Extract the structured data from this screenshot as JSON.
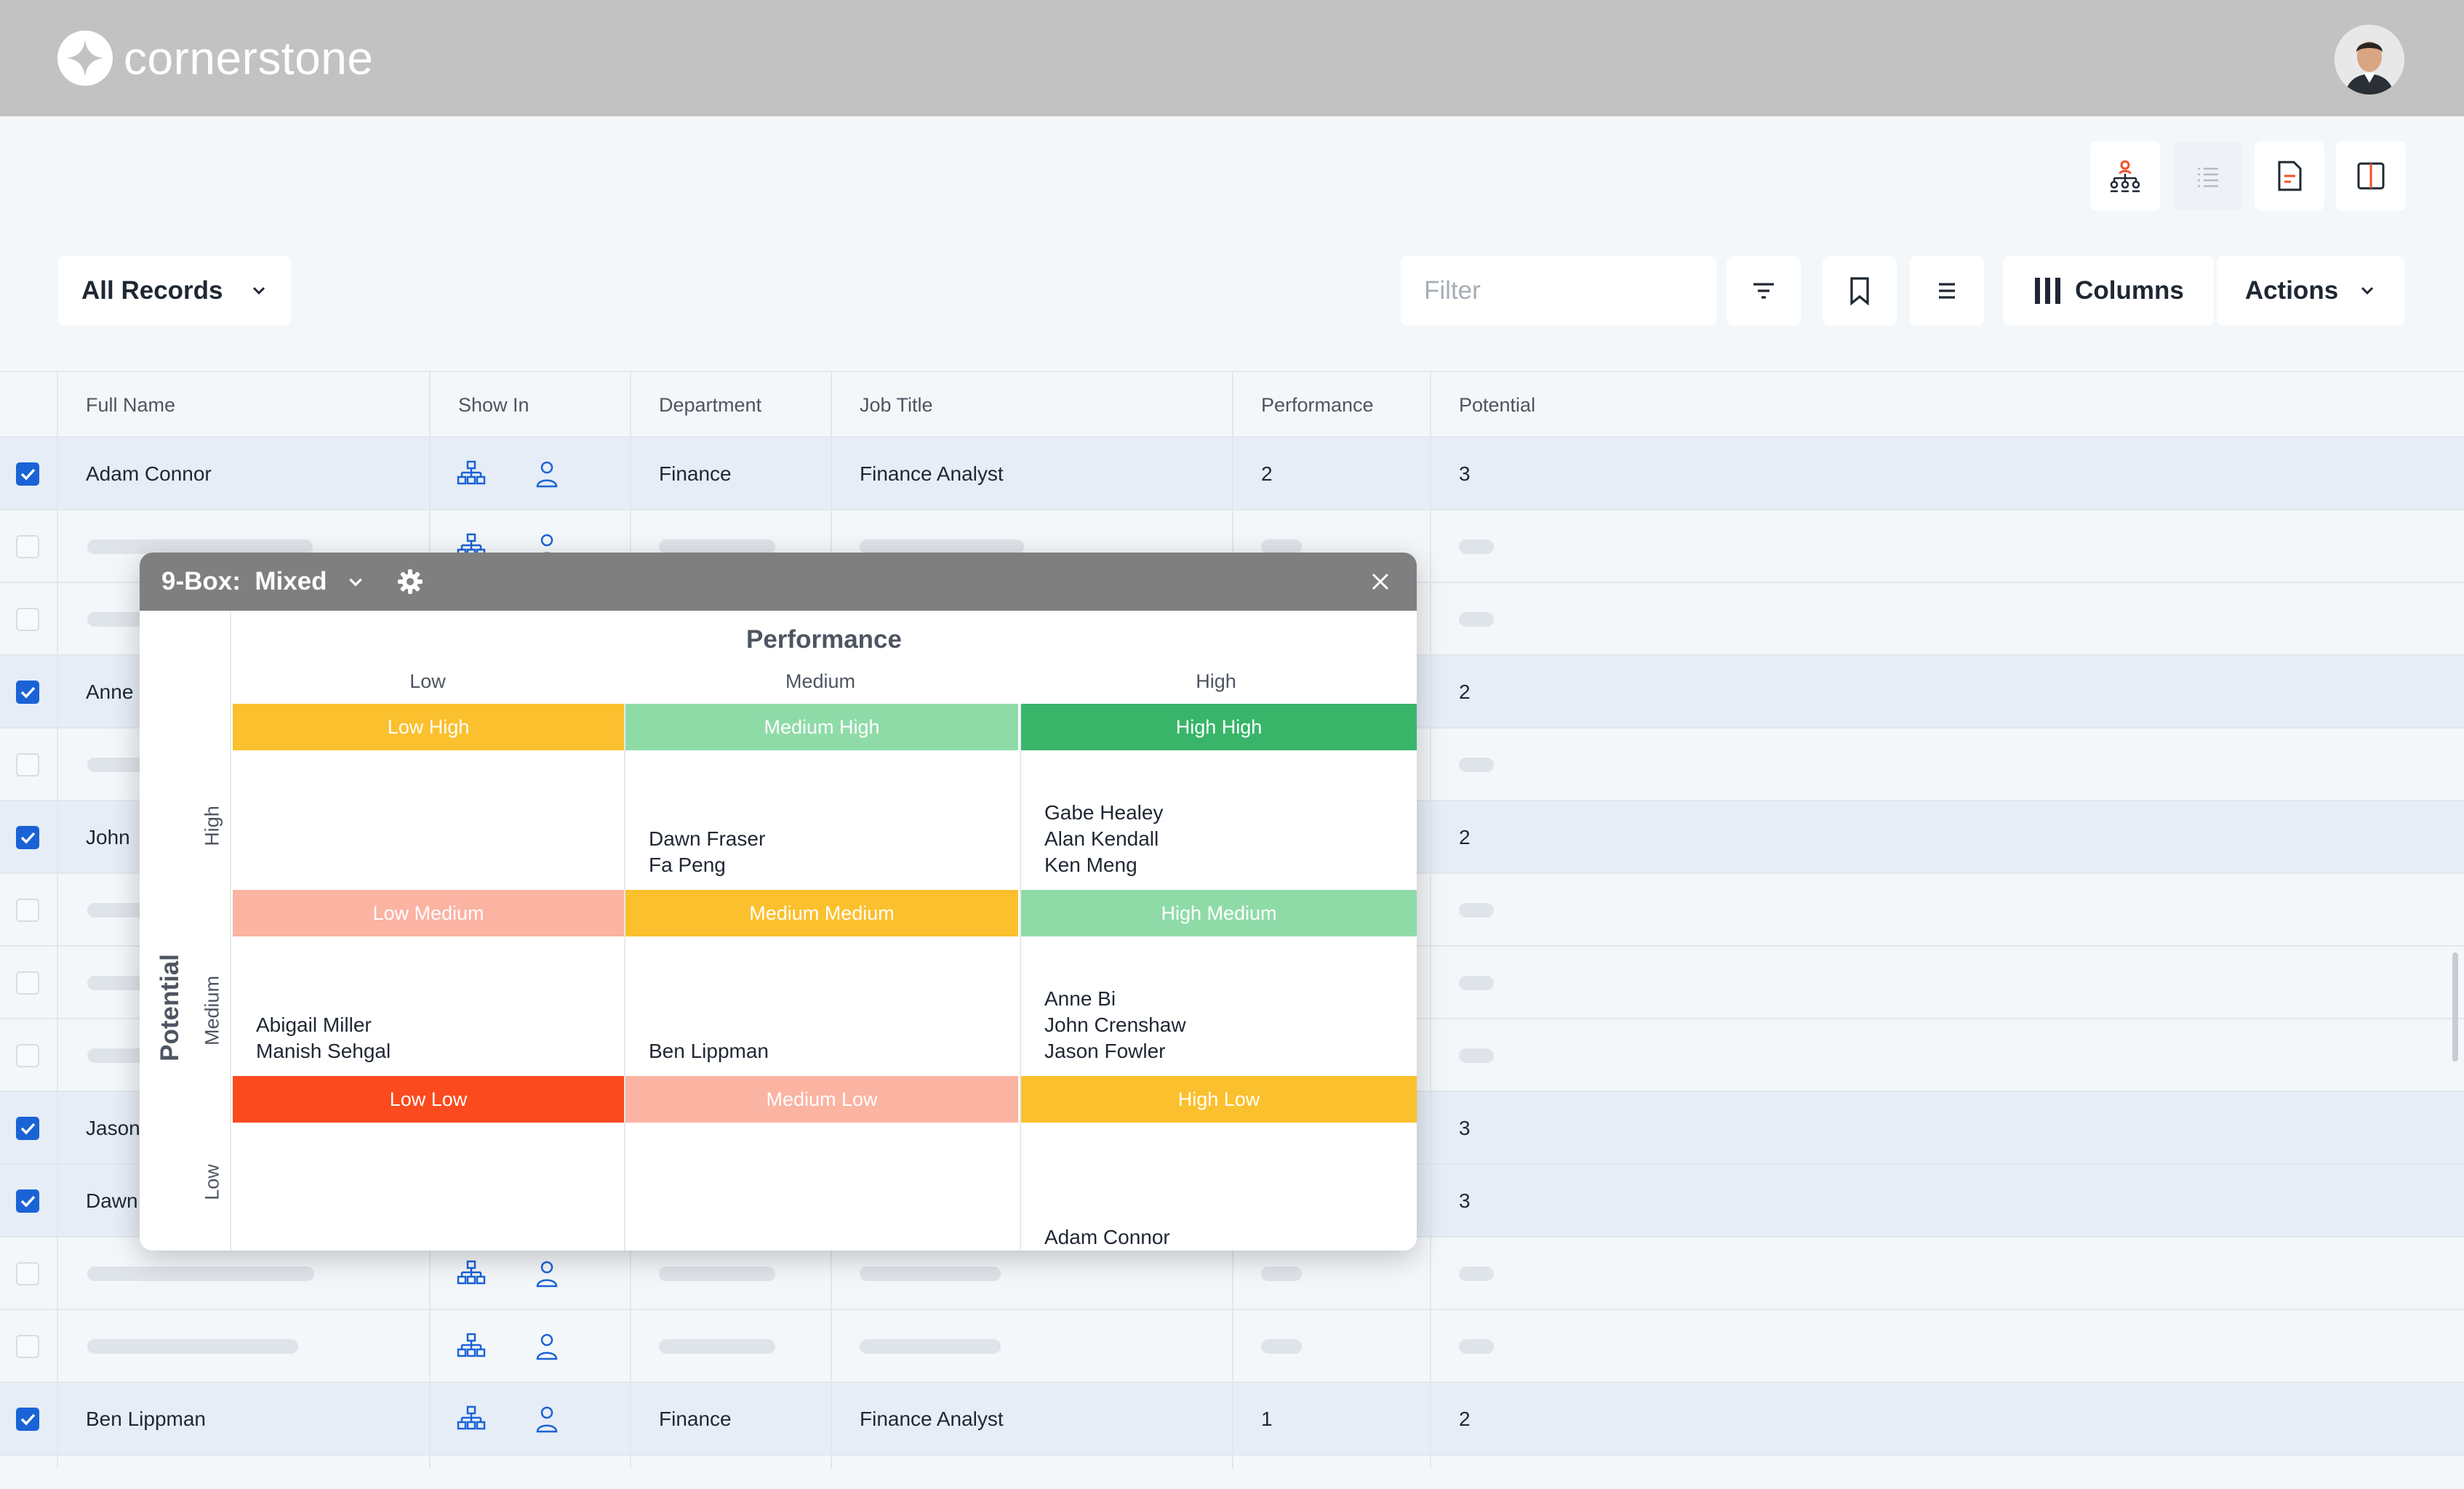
{
  "brand": {
    "name": "cornerstone"
  },
  "toolbar": {
    "view_icons": [
      "org-chart-icon",
      "list-view-icon",
      "document-icon",
      "split-view-icon"
    ],
    "records_dropdown": "All Records",
    "filter_placeholder": "Filter",
    "columns_label": "Columns",
    "actions_label": "Actions"
  },
  "table": {
    "headers": [
      "Full Name",
      "Show In",
      "Department",
      "Job Title",
      "Performance",
      "Potential"
    ],
    "rows": [
      {
        "name": "Adam Connor",
        "department": "Finance",
        "job": "Finance Analyst",
        "performance": "2",
        "potential": "3",
        "selected": true
      },
      {
        "selected": false
      },
      {
        "selected": false
      },
      {
        "name": "Anne",
        "potential": "2",
        "selected": true
      },
      {
        "selected": false
      },
      {
        "name": "John",
        "potential": "2",
        "selected": true
      },
      {
        "selected": false
      },
      {
        "selected": false
      },
      {
        "selected": false
      },
      {
        "name": "Jason",
        "potential": "3",
        "selected": true
      },
      {
        "name": "Dawn",
        "potential": "3",
        "selected": true
      },
      {
        "selected": false
      },
      {
        "selected": false
      },
      {
        "name": "Ben Lippman",
        "department": "Finance",
        "job": "Finance Analyst",
        "performance": "1",
        "potential": "2",
        "selected": true
      }
    ]
  },
  "ninebox": {
    "title": "9-Box:",
    "mode": "Mixed",
    "performance_title": "Performance",
    "performance_levels": [
      "Low",
      "Medium",
      "High"
    ],
    "potential_title": "Potential",
    "potential_levels": [
      "High",
      "Medium",
      "Low"
    ],
    "boxes": [
      {
        "label": "Low High",
        "color": "#fbc02d",
        "names": []
      },
      {
        "label": "Medium High",
        "color": "#8fdba8",
        "names": [
          "Dawn Fraser",
          "Fa Peng"
        ]
      },
      {
        "label": "High High",
        "color": "#39b56a",
        "names": [
          "Gabe Healey",
          "Alan Kendall",
          "Ken Meng"
        ]
      },
      {
        "label": "Low Medium",
        "color": "#fbb3a2",
        "names": [
          "Abigail Miller",
          "Manish Sehgal"
        ]
      },
      {
        "label": "Medium Medium",
        "color": "#fbc02d",
        "names": [
          "Ben Lippman"
        ]
      },
      {
        "label": "High Medium",
        "color": "#8fdba8",
        "names": [
          "Anne Bi",
          "John Crenshaw",
          "Jason Fowler"
        ]
      },
      {
        "label": "Low Low",
        "color": "#fc4a1f",
        "names": []
      },
      {
        "label": "Medium Low",
        "color": "#fbb3a2",
        "names": []
      },
      {
        "label": "High Low",
        "color": "#fbc02d",
        "names": [
          "Adam Connor"
        ]
      }
    ]
  }
}
